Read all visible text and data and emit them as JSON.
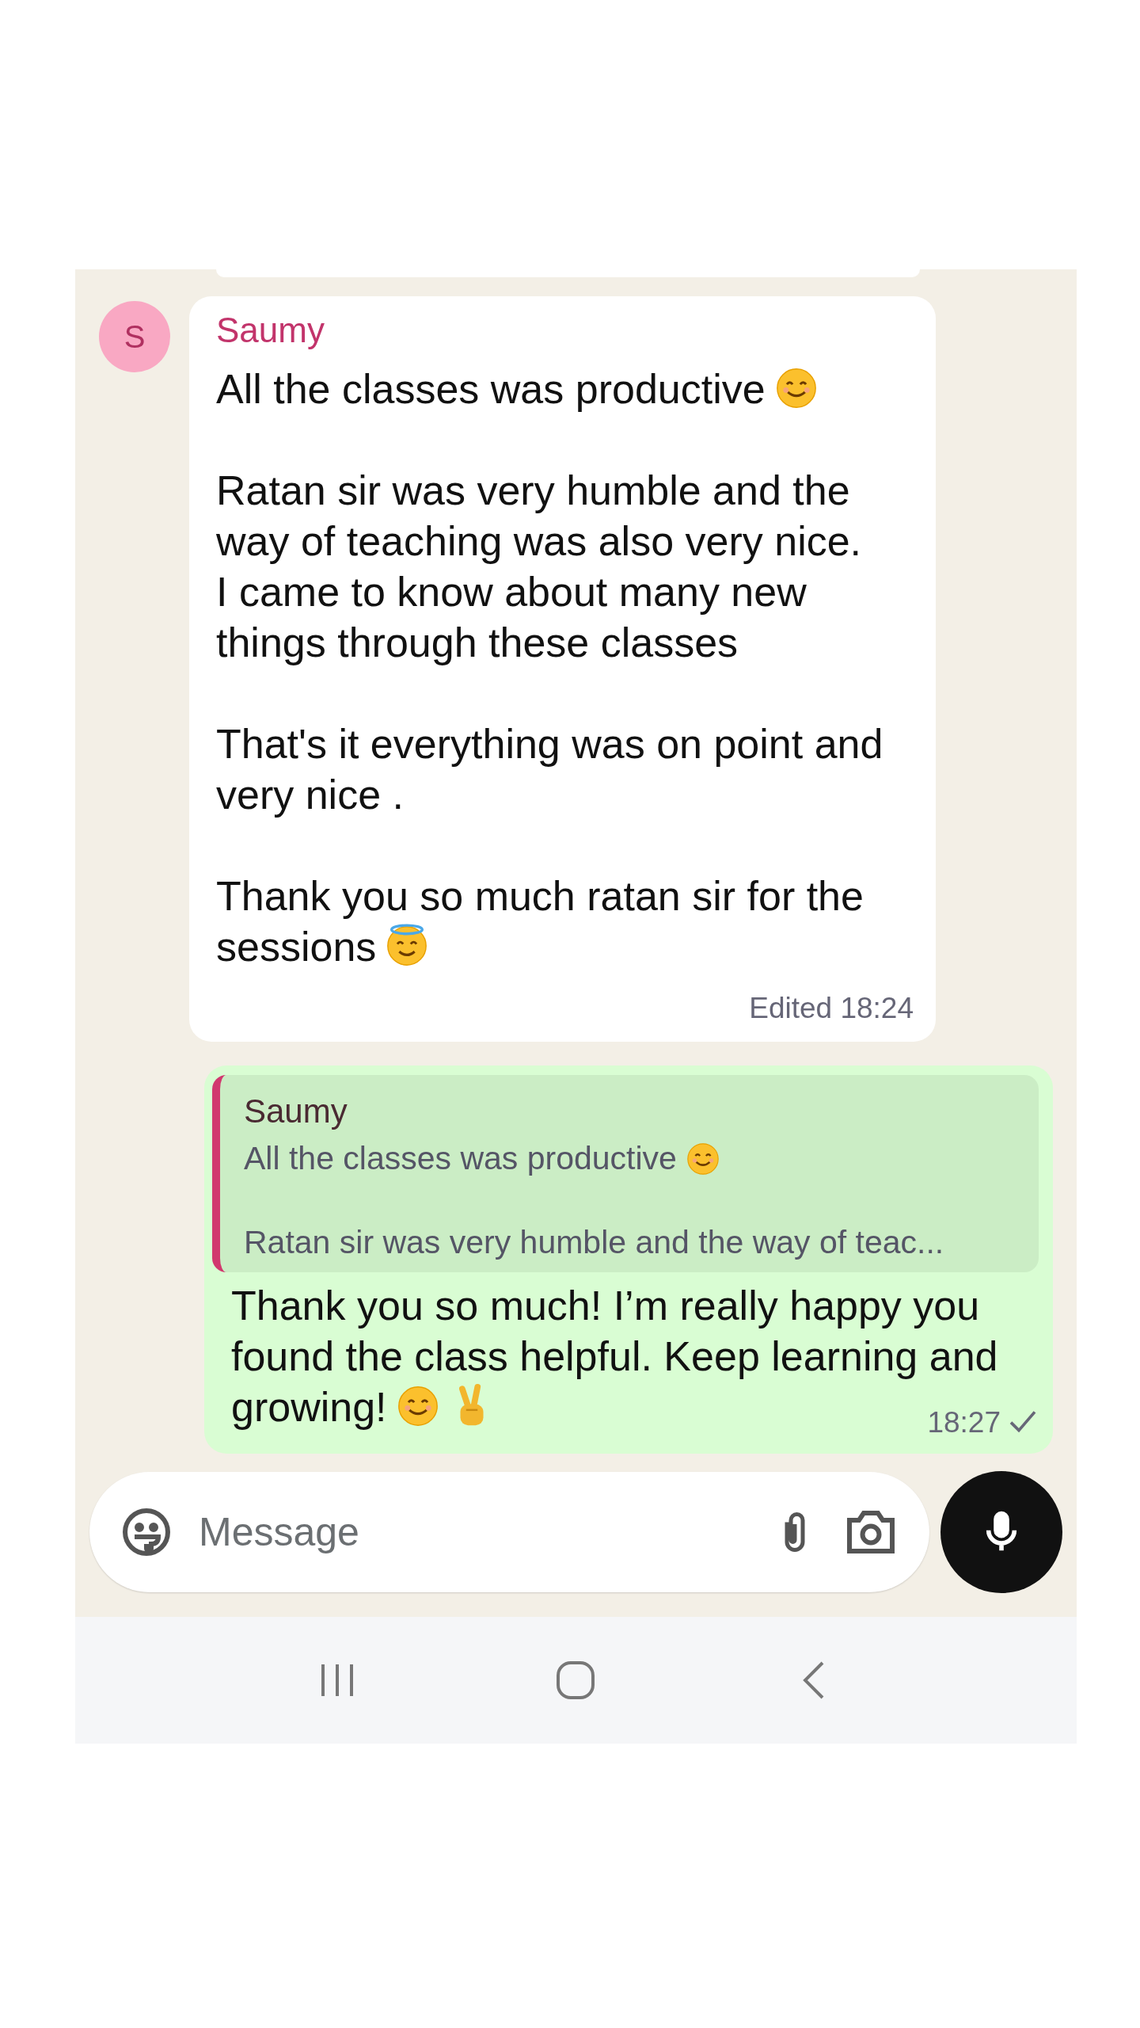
{
  "incoming": {
    "avatar_letter": "S",
    "sender": "Saumy",
    "paragraphs": [
      {
        "text": "All the classes was productive"
      },
      {
        "text": "Ratan sir was very humble and the\nway of teaching was also very nice.\nI came to know about many new\nthings through these classes"
      },
      {
        "text": "That's it everything was on point and\nvery nice ."
      },
      {
        "text": "Thank you so much ratan sir for the\nsessions"
      }
    ],
    "meta": "Edited 18:24"
  },
  "outgoing": {
    "quote": {
      "sender": "Saumy",
      "lines": [
        {
          "text": "All the classes was productive"
        },
        {
          "text": "Ratan sir was very humble and the way of teac..."
        }
      ]
    },
    "text": "Thank you so much! I’m really happy you\nfound the class helpful. Keep learning and\ngrowing!",
    "time": "18:27"
  },
  "composer": {
    "placeholder": "Message"
  }
}
